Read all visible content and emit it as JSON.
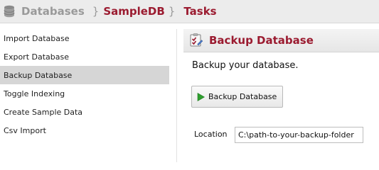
{
  "breadcrumb": {
    "root": "Databases",
    "separator": "}",
    "database": "SampleDB",
    "current": "Tasks",
    "icon": "database-icon"
  },
  "sidebar": {
    "items": [
      {
        "label": "Import Database",
        "active": false
      },
      {
        "label": "Export Database",
        "active": false
      },
      {
        "label": "Backup Database",
        "active": true
      },
      {
        "label": "Toggle Indexing",
        "active": false
      },
      {
        "label": "Create Sample Data",
        "active": false
      },
      {
        "label": "Csv Import",
        "active": false
      }
    ]
  },
  "panel": {
    "title": "Backup Database",
    "icon": "backup-checklist-icon",
    "description": "Backup your database.",
    "button_label": "Backup Database",
    "button_icon": "play-icon",
    "location_label": "Location",
    "location_value": "C:\\path-to-your-backup-folder"
  },
  "colors": {
    "accent": "#9b1b30",
    "muted": "#9a9a9a",
    "active_item": "#d6d6d6",
    "play_green": "#2e9e2e"
  }
}
